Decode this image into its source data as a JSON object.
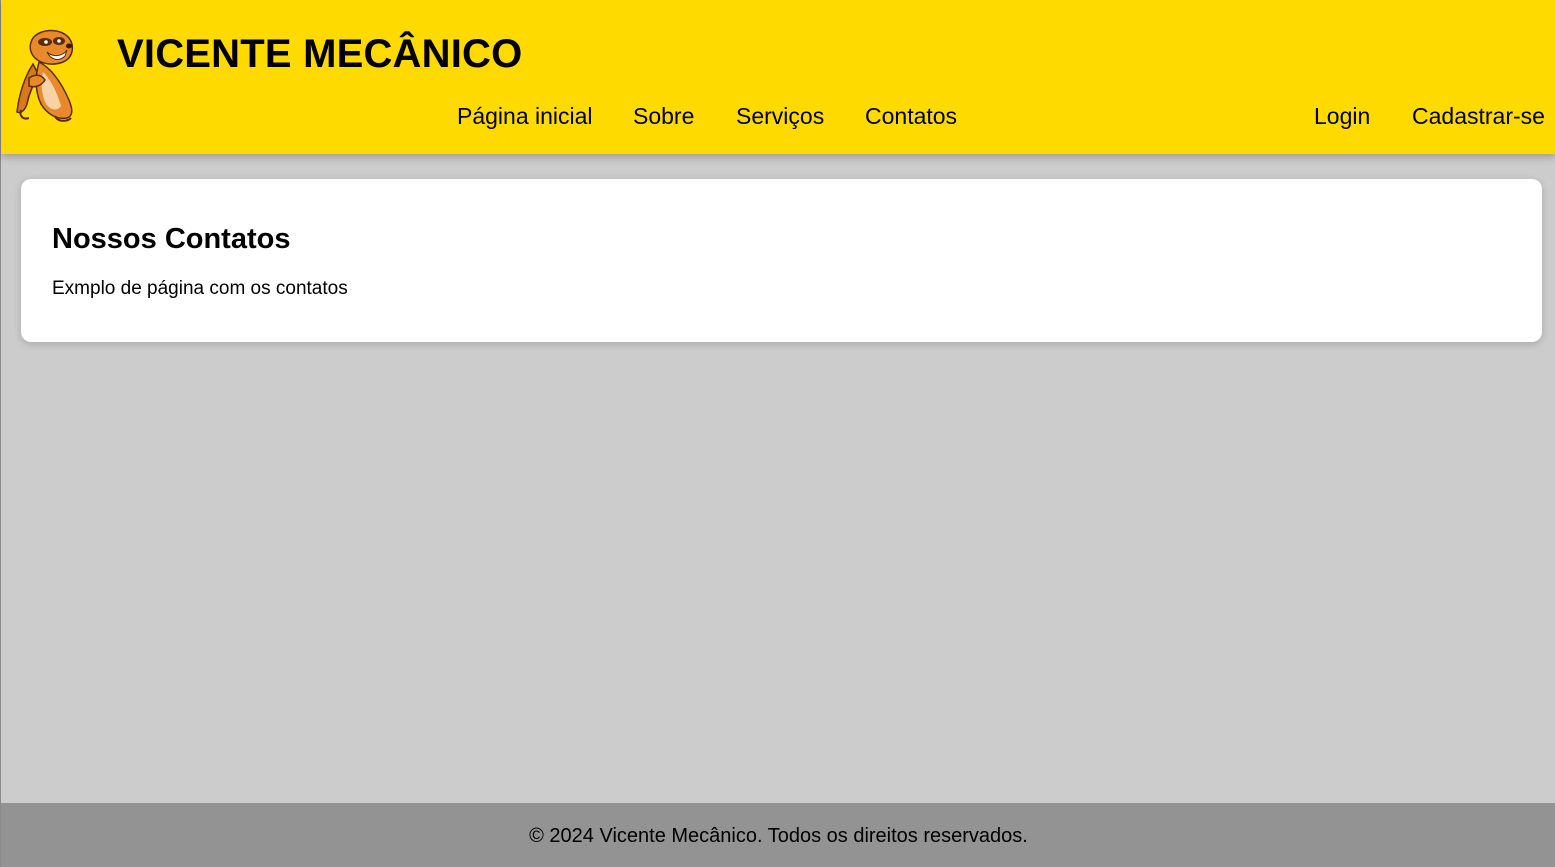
{
  "header": {
    "title": "VICENTE MECÂNICO",
    "logo_icon": "meerkat-mascot-icon",
    "background": "#ffda00",
    "nav": [
      {
        "label": "Página inicial"
      },
      {
        "label": "Sobre"
      },
      {
        "label": "Serviços"
      },
      {
        "label": "Contatos"
      }
    ],
    "auth": [
      {
        "label": "Login"
      },
      {
        "label": "Cadastrar-se"
      }
    ]
  },
  "main": {
    "heading": "Nossos Contatos",
    "text": "Exmplo de página com os contatos"
  },
  "footer": {
    "text": "© 2024 Vicente Mecânico. Todos os direitos reservados.",
    "background": "#939393"
  }
}
